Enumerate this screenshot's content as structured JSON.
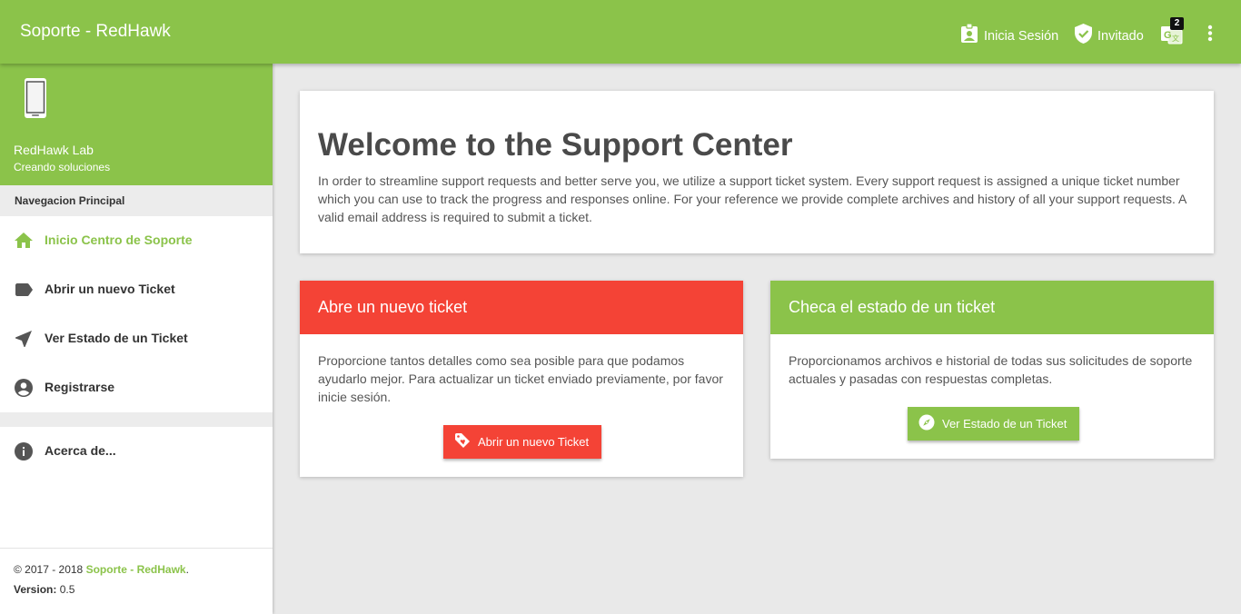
{
  "header": {
    "title": "Soporte - RedHawk",
    "login_label": "Inicia Sesión",
    "guest_label": "Invitado",
    "lang_badge": "2",
    "accent_color": "#8bc34a"
  },
  "sidebar": {
    "org_name": "RedHawk Lab",
    "org_tagline": "Creando soluciones",
    "nav_title": "Navegacion Principal",
    "items": [
      {
        "label": "Inicio Centro de Soporte",
        "icon": "home-icon",
        "active": true
      },
      {
        "label": "Abrir un nuevo Ticket",
        "icon": "label-icon",
        "active": false
      },
      {
        "label": "Ver Estado de un Ticket",
        "icon": "navigation-arrow-icon",
        "active": false
      },
      {
        "label": "Registrarse",
        "icon": "account-circle-icon",
        "active": false
      }
    ],
    "about_label": "Acerca de...",
    "footer": {
      "copyright": "© 2017 - 2018",
      "brand": "Soporte - RedHawk",
      "brand_suffix": ".",
      "version_label": "Version:",
      "version_value": "0.5"
    }
  },
  "main": {
    "welcome": {
      "title": "Welcome to the Support Center",
      "text": "In order to streamline support requests and better serve you, we utilize a support ticket system. Every support request is assigned a unique ticket number which you can use to track the progress and responses online. For your reference we provide complete archives and history of all your support requests. A valid email address is required to submit a ticket."
    },
    "open_ticket": {
      "heading": "Abre un nuevo ticket",
      "text": "Proporcione tantos detalles como sea posible para que podamos ayudarlo mejor. Para actualizar un ticket enviado previamente, por favor inicie sesión.",
      "button": "Abrir un nuevo Ticket",
      "color": "#f44336"
    },
    "check_status": {
      "heading": "Checa el estado de un ticket",
      "text": "Proporcionamos archivos e historial de todas sus solicitudes de soporte actuales y pasadas con respuestas completas.",
      "button": "Ver Estado de un Ticket",
      "color": "#8bc34a"
    }
  }
}
